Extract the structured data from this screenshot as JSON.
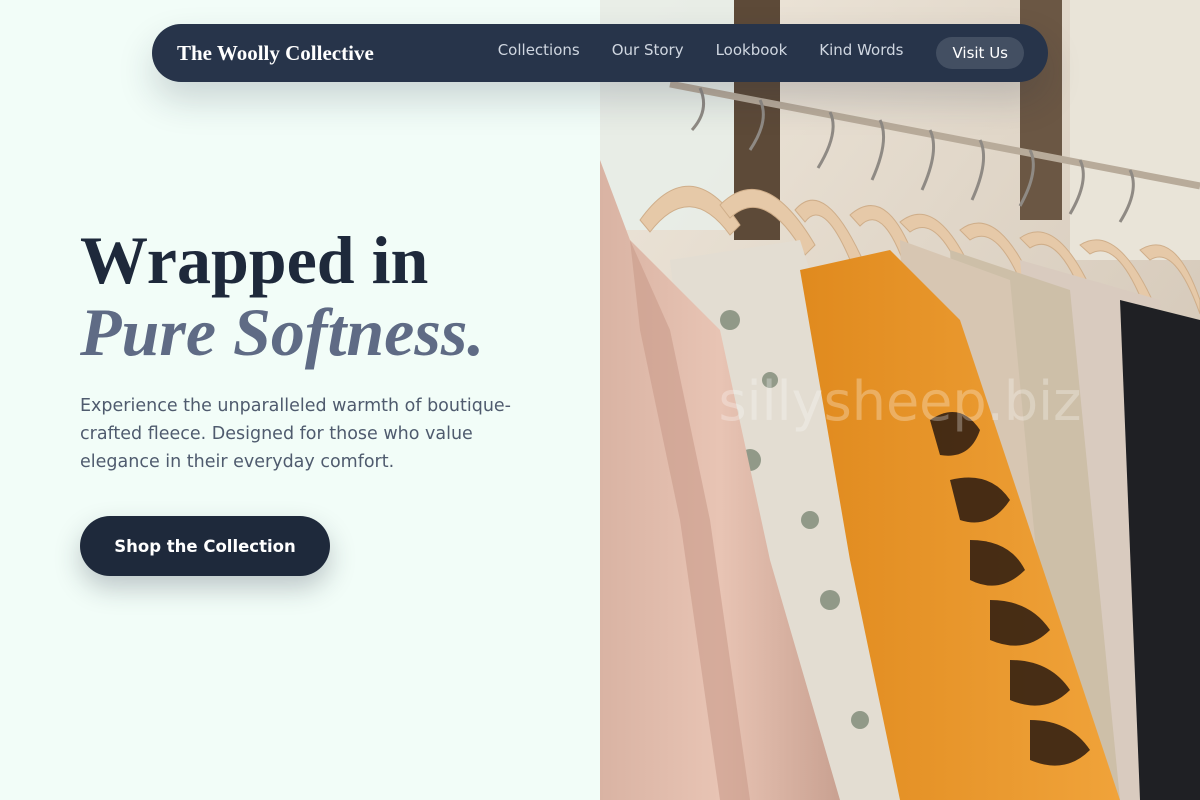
{
  "nav": {
    "brand": "The Woolly Collective",
    "links": [
      "Collections",
      "Our Story",
      "Lookbook",
      "Kind Words"
    ],
    "cta_label": "Visit Us"
  },
  "hero": {
    "headline_line1": "Wrapped in",
    "headline_line2": "Pure Softness.",
    "subtext": "Experience the unparalleled warmth of boutique-crafted fleece. Designed for those who value elegance in their everyday comfort.",
    "cta_label": "Shop the Collection"
  },
  "photo": {
    "subject": "clothing rack with garments on wooden hangers",
    "watermark": "sillysheep.biz"
  },
  "colors": {
    "page_background": "#f2fdf8",
    "navbar_background": "#27344a",
    "heading_dark": "#1e293b",
    "heading_accent": "#5f6b85",
    "body_text": "#4f5b6e",
    "cta_background": "#1e293b"
  }
}
